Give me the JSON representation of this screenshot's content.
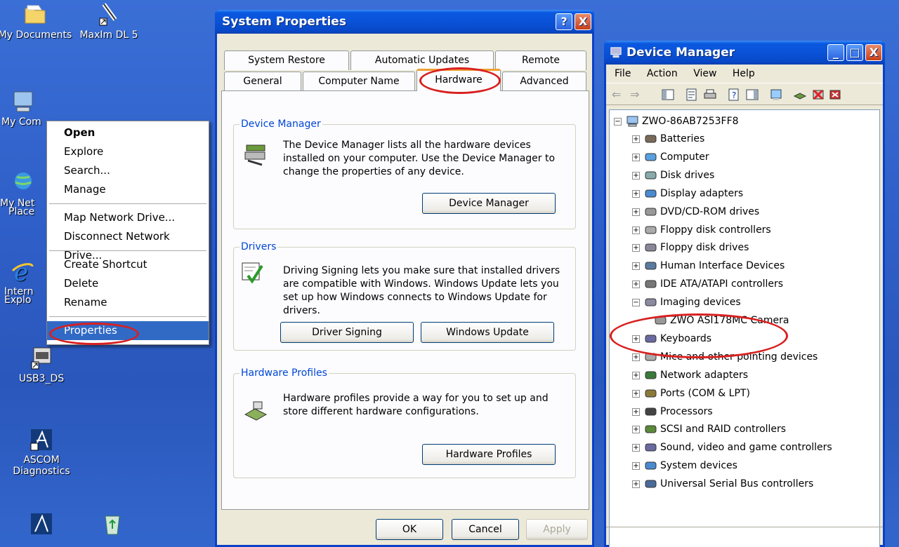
{
  "desktop": {
    "icons": [
      {
        "label": "My Documents",
        "icon": "my-documents-folder-icon"
      },
      {
        "label": "MaxIm DL 5",
        "icon": "maxim-dl-shortcut-icon"
      },
      {
        "label": "My Com",
        "icon": "my-computer-icon"
      },
      {
        "label": "My Net",
        "label2": "Place",
        "icon": "my-network-places-icon"
      },
      {
        "label": "Intern",
        "label2": "Explo",
        "icon": "internet-explorer-icon"
      },
      {
        "label": "USB3_DS",
        "icon": "usb3-shortcut-icon"
      },
      {
        "label": "ASCOM",
        "label2": "Diagnostics",
        "icon": "ascom-diagnostics-icon"
      }
    ]
  },
  "context_menu": {
    "items": [
      "Open",
      "Explore",
      "Search...",
      "Manage"
    ],
    "items2": [
      "Map Network Drive...",
      "Disconnect Network Drive..."
    ],
    "items3": [
      "Create Shortcut",
      "Delete",
      "Rename"
    ],
    "items4": [
      "Properties"
    ]
  },
  "system_properties": {
    "title": "System Properties",
    "help_btn": "?",
    "close_btn": "X",
    "tabs_top": [
      "System Restore",
      "Automatic Updates",
      "Remote"
    ],
    "tabs_bottom": [
      "General",
      "Computer Name",
      "Hardware",
      "Advanced"
    ],
    "device_manager": {
      "title": "Device Manager",
      "text": "The Device Manager lists all the hardware devices installed on your computer. Use the Device Manager to change the properties of any device.",
      "button": "Device Manager"
    },
    "drivers": {
      "title": "Drivers",
      "text": "Driving Signing lets you make sure that installed drivers are compatible with Windows. Windows Update lets you set up how Windows connects to Windows Update for drivers.",
      "button1": "Driver Signing",
      "button2": "Windows Update"
    },
    "hardware_profiles": {
      "title": "Hardware Profiles",
      "text": "Hardware profiles provide a way for you to set up and store different hardware configurations.",
      "button": "Hardware Profiles"
    },
    "ok": "OK",
    "cancel": "Cancel",
    "apply": "Apply"
  },
  "device_manager_window": {
    "title": "Device Manager",
    "minimize": "_",
    "maximize": "□",
    "close": "X",
    "menu": [
      "File",
      "Action",
      "View",
      "Help"
    ],
    "root": "ZWO-86AB7253FF8",
    "nodes": [
      {
        "label": "Batteries",
        "expanded": false
      },
      {
        "label": "Computer",
        "expanded": false
      },
      {
        "label": "Disk drives",
        "expanded": false
      },
      {
        "label": "Display adapters",
        "expanded": false
      },
      {
        "label": "DVD/CD-ROM drives",
        "expanded": false
      },
      {
        "label": "Floppy disk controllers",
        "expanded": false
      },
      {
        "label": "Floppy disk drives",
        "expanded": false
      },
      {
        "label": "Human Interface Devices",
        "expanded": false
      },
      {
        "label": "IDE ATA/ATAPI controllers",
        "expanded": false
      },
      {
        "label": "Imaging devices",
        "expanded": true
      },
      {
        "label": "ZWO ASI178MC Camera",
        "child": true
      },
      {
        "label": "Keyboards",
        "expanded": false
      },
      {
        "label": "Mice and other pointing devices",
        "expanded": false
      },
      {
        "label": "Network adapters",
        "expanded": false
      },
      {
        "label": "Ports (COM & LPT)",
        "expanded": false
      },
      {
        "label": "Processors",
        "expanded": false
      },
      {
        "label": "SCSI and RAID controllers",
        "expanded": false
      },
      {
        "label": "Sound, video and game controllers",
        "expanded": false
      },
      {
        "label": "System devices",
        "expanded": false
      },
      {
        "label": "Universal Serial Bus controllers",
        "expanded": false
      }
    ]
  },
  "colors": {
    "xp_blue": "#0a52d8",
    "highlight": "#316ac5",
    "annotation_red": "#d82020",
    "group_title": "#0046d5"
  }
}
